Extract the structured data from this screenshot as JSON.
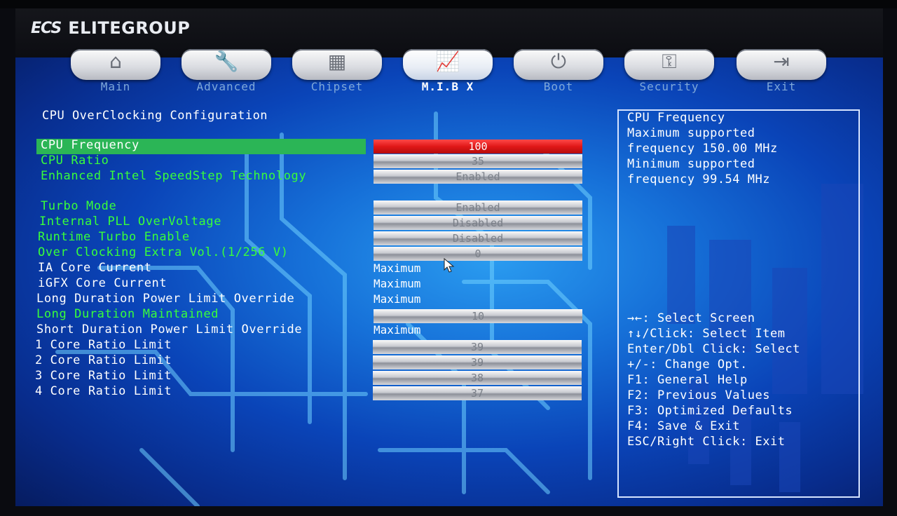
{
  "brand": {
    "mark": "ECS",
    "name": "ELITEGROUP"
  },
  "tabs": [
    {
      "label": "Main",
      "icon": "home-icon",
      "glyph": "⌂"
    },
    {
      "label": "Advanced",
      "icon": "wrench-icon",
      "glyph": "🔧"
    },
    {
      "label": "Chipset",
      "icon": "chip-icon",
      "glyph": "▦"
    },
    {
      "label": "M.I.B X",
      "icon": "chart-icon",
      "glyph": "📈"
    },
    {
      "label": "Boot",
      "icon": "power-icon",
      "glyph": "⏻"
    },
    {
      "label": "Security",
      "icon": "key-icon",
      "glyph": "⚿"
    },
    {
      "label": "Exit",
      "icon": "exit-icon",
      "glyph": "⇥"
    }
  ],
  "active_tab": "M.I.B X",
  "section_title": "CPU OverClocking Configuration",
  "rows": [
    {
      "label": "CPU Frequency",
      "value": "100",
      "style": "bar"
    },
    {
      "label": "CPU Ratio",
      "value": "35",
      "style": "bar"
    },
    {
      "label": "Enhanced Intel SpeedStep Technology",
      "value": "Enabled",
      "style": "bar"
    },
    {
      "label": "Turbo Mode",
      "value": "Enabled",
      "style": "bar"
    },
    {
      "label": "Internal PLL OverVoltage",
      "value": "Disabled",
      "style": "bar"
    },
    {
      "label": "Runtime Turbo Enable",
      "value": "Disabled",
      "style": "bar"
    },
    {
      "label": "Over Clocking Extra Vol.(1/256 V)",
      "value": "0",
      "style": "bar"
    },
    {
      "label": "IA Core Current",
      "value": "Maximum",
      "style": "text"
    },
    {
      "label": "iGFX Core Current",
      "value": "Maximum",
      "style": "text"
    },
    {
      "label": "Long Duration Power Limit Override",
      "value": "Maximum",
      "style": "text"
    },
    {
      "label": "Long Duration Maintained",
      "value": "10",
      "style": "bar"
    },
    {
      "label": "Short Duration Power Limit Override",
      "value": "Maximum",
      "style": "text"
    },
    {
      "label": "1 Core Ratio Limit",
      "value": "39",
      "style": "bar"
    },
    {
      "label": "2 Core Ratio Limit",
      "value": "39",
      "style": "bar"
    },
    {
      "label": "3 Core Ratio Limit",
      "value": "38",
      "style": "bar"
    },
    {
      "label": "4 Core Ratio Limit",
      "value": "37",
      "style": "bar"
    }
  ],
  "selected_row": "CPU Frequency",
  "help": {
    "description": [
      "CPU Frequency",
      "Maximum supported",
      "frequency 150.00 MHz",
      "Minimum supported",
      "frequency 99.54 MHz"
    ],
    "keys": [
      "→←: Select Screen",
      "↑↓/Click: Select Item",
      "Enter/Dbl Click: Select",
      "+/-: Change Opt.",
      "F1: General Help",
      "F2: Previous Values",
      "F3: Optimized Defaults",
      "F4: Save & Exit",
      "ESC/Right Click: Exit"
    ]
  },
  "colors": {
    "label_green": "#38ff3a",
    "highlight": "#2bb556",
    "selected_value": "#e01818",
    "help_border": "#d6e4ff"
  }
}
